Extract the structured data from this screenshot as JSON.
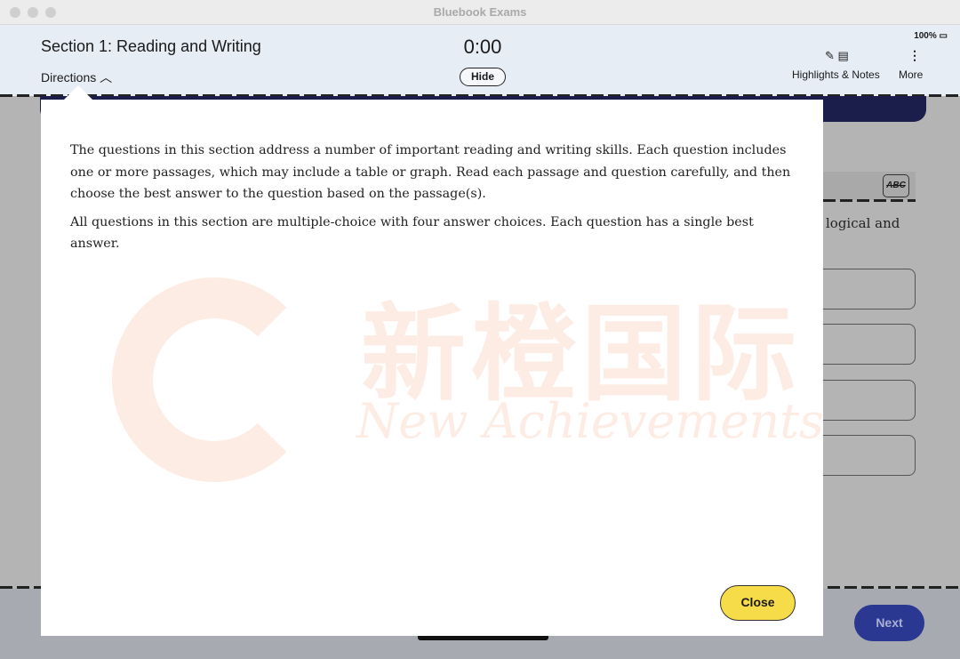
{
  "window": {
    "title": "Bluebook Exams"
  },
  "header": {
    "section_title": "Section 1: Reading and Writing",
    "directions_label": "Directions",
    "directions_icon": "chevron-up-icon",
    "timer": "0:00",
    "hide_label": "Hide",
    "battery": "100%",
    "highlights_label": "Highlights & Notes",
    "more_label": "More"
  },
  "directions": {
    "paragraphs": [
      "The questions in this section address a number of important reading and writing skills. Each question includes one or more passages, which may include a table or graph. Read each passage and question carefully, and then choose the best answer to the question based on the passage(s).",
      "All questions in this section are multiple-choice with four answer choices. Each question has a single best answer."
    ],
    "close_label": "Close"
  },
  "background": {
    "question_fragment": "logical and",
    "abc_label": "ABC",
    "next_label": "Next"
  },
  "watermark": {
    "zh": "新橙国际",
    "en": "New Achievements"
  },
  "colors": {
    "header_bg": "#e6edf5",
    "close_button": "#f7dc49",
    "next_button": "#2a3891",
    "navy": "#1b1d4a"
  }
}
